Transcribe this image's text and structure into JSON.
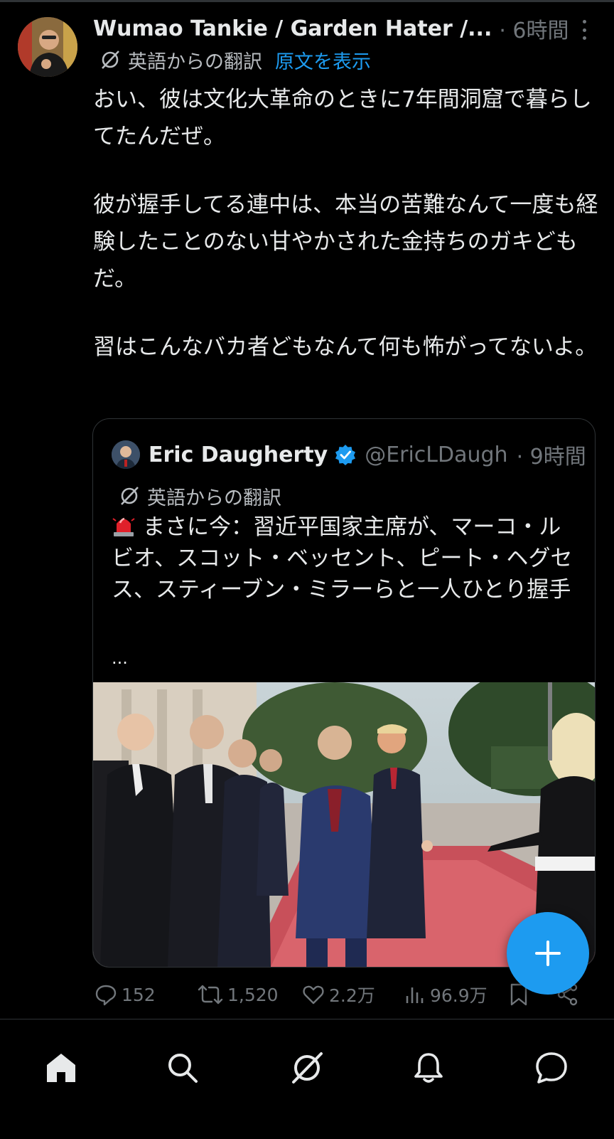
{
  "tweet": {
    "author_name": "Wumao Tankie / Garden Hater /...",
    "time": "· 6時間",
    "translation_label": "英語からの翻訳",
    "show_original": "原文を表示",
    "paragraphs": [
      "おい、彼は文化大革命のときに7年間洞窟で暮らしてたんだぜ。",
      "彼が握手してる連中は、本当の苦難なんて一度も経験したことのない甘やかされた金持ちのガキどもだ。",
      "習はこんなバカ者どもなんて何も怖がってないよ。"
    ]
  },
  "quote": {
    "author_name": "Eric Daugherty",
    "handle": "@EricLDaugh",
    "time": "· 9時間",
    "translation_label": "英語からの翻訳",
    "body": "まさに今：習近平国家主席が、マーコ・ルビオ、スコット・ベッセント、ピート・ヘグセス、スティーブン・ミラーらと一人ひとり握手",
    "more": "..."
  },
  "actions": {
    "replies": "152",
    "reposts": "1,520",
    "likes": "2.2万",
    "views": "96.9万"
  },
  "nav": {
    "items": [
      "home-icon",
      "search-icon",
      "grok-icon",
      "bell-icon",
      "messages-icon"
    ]
  },
  "colors": {
    "accent": "#1d9bf0",
    "muted": "#71767b",
    "text": "#e7e9ea",
    "background": "#000000"
  }
}
